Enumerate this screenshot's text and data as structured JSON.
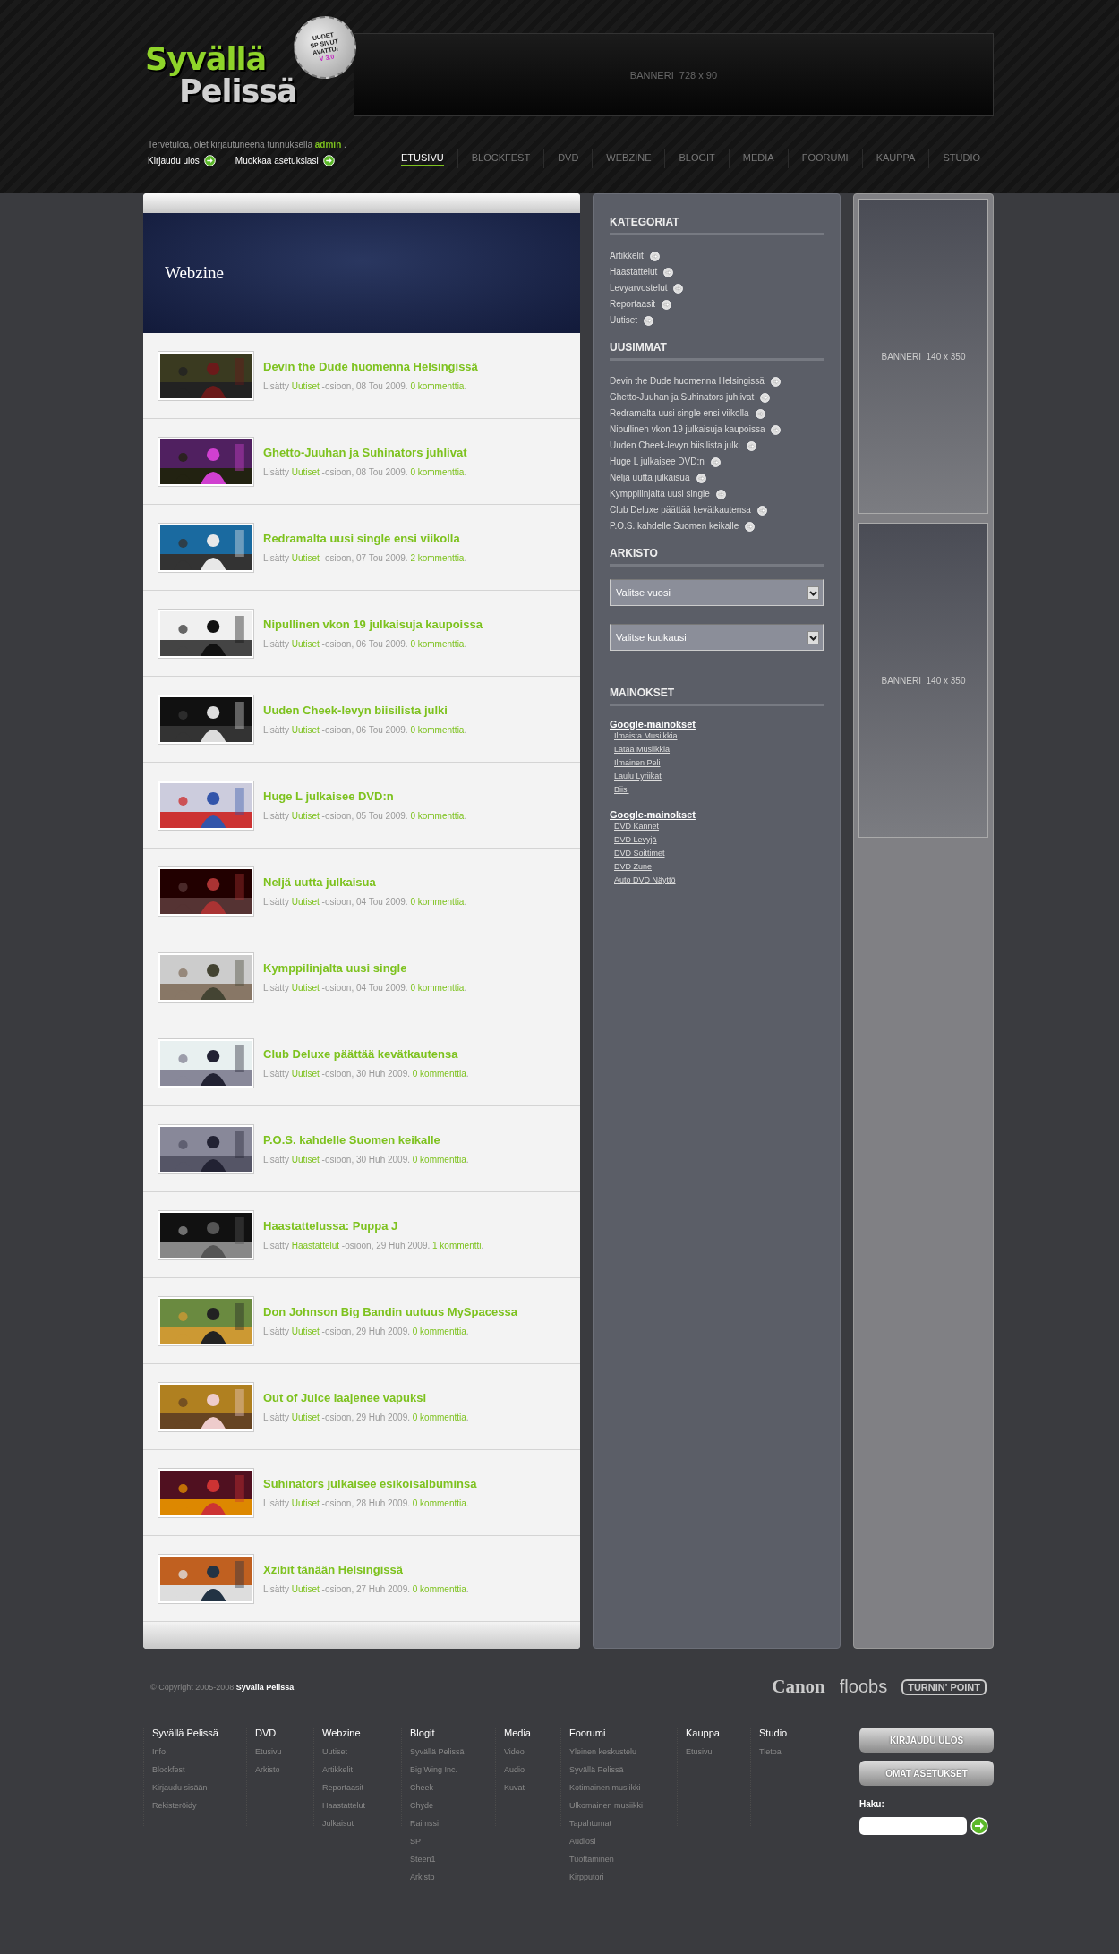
{
  "logo": {
    "line_1": "Syvällä",
    "line_2": "Pelissä",
    "badge": [
      "UUDET",
      "SP SIVUT",
      "AVATTU!"
    ],
    "badge_version": "V 3.0"
  },
  "top_banner": "BANNERI  728 x 90",
  "welcome": {
    "text_before": "Tervetuloa, olet kirjautuneena tunnuksella",
    "user": "admin",
    "text_after": "."
  },
  "user_links": [
    "Kirjaudu ulos",
    "Muokkaa asetuksiasi"
  ],
  "nav": [
    {
      "label": "ETUSIVU",
      "selected": true
    },
    {
      "label": "BLOCKFEST",
      "selected": false
    },
    {
      "label": "DVD",
      "selected": false
    },
    {
      "label": "WEBZINE",
      "selected": false
    },
    {
      "label": "BLOGIT",
      "selected": false
    },
    {
      "label": "MEDIA",
      "selected": false
    },
    {
      "label": "FOORUMI",
      "selected": false
    },
    {
      "label": "KAUPPA",
      "selected": false
    },
    {
      "label": "STUDIO",
      "selected": false
    }
  ],
  "section_title": "Webzine",
  "articles": [
    {
      "title": "Devin the Dude huomenna Helsingissä",
      "prefix": "Lisätty",
      "category": "Uutiset",
      "date": "-osioon, 08 Tou 2009.",
      "comments": "0 kommenttia",
      "end": "."
    },
    {
      "title": "Ghetto-Juuhan ja Suhinators juhlivat",
      "prefix": "Lisätty",
      "category": "Uutiset",
      "date": "-osioon, 08 Tou 2009.",
      "comments": "0 kommenttia",
      "end": "."
    },
    {
      "title": "Redramalta uusi single ensi viikolla",
      "prefix": "Lisätty",
      "category": "Uutiset",
      "date": "-osioon, 07 Tou 2009.",
      "comments": "2 kommenttia",
      "end": "."
    },
    {
      "title": "Nipullinen vkon 19 julkaisuja kaupoissa",
      "prefix": "Lisätty",
      "category": "Uutiset",
      "date": "-osioon, 06 Tou 2009.",
      "comments": "0 kommenttia",
      "end": "."
    },
    {
      "title": "Uuden Cheek-levyn biisilista julki",
      "prefix": "Lisätty",
      "category": "Uutiset",
      "date": "-osioon, 06 Tou 2009.",
      "comments": "0 kommenttia",
      "end": "."
    },
    {
      "title": "Huge L julkaisee DVD:n",
      "prefix": "Lisätty",
      "category": "Uutiset",
      "date": "-osioon, 05 Tou 2009.",
      "comments": "0 kommenttia",
      "end": "."
    },
    {
      "title": "Neljä uutta julkaisua",
      "prefix": "Lisätty",
      "category": "Uutiset",
      "date": "-osioon, 04 Tou 2009.",
      "comments": "0 kommenttia",
      "end": "."
    },
    {
      "title": "Kymppilinjalta uusi single",
      "prefix": "Lisätty",
      "category": "Uutiset",
      "date": "-osioon, 04 Tou 2009.",
      "comments": "0 kommenttia",
      "end": "."
    },
    {
      "title": "Club Deluxe päättää kevätkautensa",
      "prefix": "Lisätty",
      "category": "Uutiset",
      "date": "-osioon, 30 Huh 2009.",
      "comments": "0 kommenttia",
      "end": "."
    },
    {
      "title": "P.O.S. kahdelle Suomen keikalle",
      "prefix": "Lisätty",
      "category": "Uutiset",
      "date": "-osioon, 30 Huh 2009.",
      "comments": "0 kommenttia",
      "end": "."
    },
    {
      "title": "Haastattelussa: Puppa J",
      "prefix": "Lisätty",
      "category": "Haastattelut",
      "date": "-osioon, 29 Huh 2009.",
      "comments": "1 kommentti",
      "end": "."
    },
    {
      "title": "Don Johnson Big Bandin uutuus MySpacessa",
      "prefix": "Lisätty",
      "category": "Uutiset",
      "date": "-osioon, 29 Huh 2009.",
      "comments": "0 kommenttia",
      "end": "."
    },
    {
      "title": "Out of Juice laajenee vapuksi",
      "prefix": "Lisätty",
      "category": "Uutiset",
      "date": "-osioon, 29 Huh 2009.",
      "comments": "0 kommenttia",
      "end": "."
    },
    {
      "title": "Suhinators julkaisee esikoisalbuminsa",
      "prefix": "Lisätty",
      "category": "Uutiset",
      "date": "-osioon, 28 Huh 2009.",
      "comments": "0 kommenttia",
      "end": "."
    },
    {
      "title": "Xzibit tänään Helsingissä",
      "prefix": "Lisätty",
      "category": "Uutiset",
      "date": "-osioon, 27 Huh 2009.",
      "comments": "0 kommenttia",
      "end": "."
    }
  ],
  "sidebar": {
    "categories": {
      "title": "KATEGORIAT",
      "items": [
        "Artikkelit",
        "Haastattelut",
        "Levyarvostelut",
        "Reportaasit",
        "Uutiset"
      ]
    },
    "latest": {
      "title": "UUSIMMAT",
      "items": [
        "Devin the Dude huomenna Helsingissä",
        "Ghetto-Juuhan ja Suhinators juhlivat",
        "Redramalta uusi single ensi viikolla",
        "Nipullinen vkon 19 julkaisuja kaupoissa",
        "Uuden Cheek-levyn biisilista julki",
        "Huge L julkaisee DVD:n",
        "Neljä uutta julkaisua",
        "Kymppilinjalta uusi single",
        "Club Deluxe päättää kevätkautensa",
        "P.O.S. kahdelle Suomen keikalle"
      ]
    },
    "archive": {
      "title": "ARKISTO",
      "selects": [
        {
          "value": "Valitse vuosi"
        },
        {
          "value": "Valitse kuukausi"
        }
      ]
    },
    "ads": {
      "title": "MAINOKSET",
      "groups": [
        {
          "heading": "Google-mainokset",
          "links": [
            "Ilmaista Musiikkia",
            "Lataa Musiikkia",
            "Ilmainen Peli",
            "Laulu Lyriikat",
            "Biisi"
          ]
        },
        {
          "heading": "Google-mainokset",
          "links": [
            "DVD Kannet",
            "DVD Levyjä",
            "DVD Soittimet",
            "DVD Zune",
            "Auto DVD Näyttö"
          ]
        }
      ]
    }
  },
  "side_banners": [
    "BANNERI  140 x 350",
    "BANNERI  140 x 350"
  ],
  "footer": {
    "copyright": "© Copyright 2005-2008",
    "site": "Syvällä Pelissä",
    "copyright_end": ".",
    "sponsors": [
      "Canon",
      "floobs",
      "TURNIN' POINT"
    ],
    "columns": [
      {
        "heading": "Syvällä Pelissä",
        "links": [
          "Info",
          "Blockfest",
          "Kirjaudu sisään",
          "Rekisteröidy"
        ]
      },
      {
        "heading": "DVD",
        "links": [
          "Etusivu",
          "Arkisto"
        ]
      },
      {
        "heading": "Webzine",
        "links": [
          "Uutiset",
          "Artikkelit",
          "Reportaasit",
          "Haastattelut",
          "Julkaisut"
        ]
      },
      {
        "heading": "Blogit",
        "links": [
          "Syvällä Pelissä",
          "Big Wing Inc.",
          "Cheek",
          "Chyde",
          "Raimssi",
          "SP",
          "Steen1",
          "Arkisto"
        ]
      },
      {
        "heading": "Media",
        "links": [
          "Video",
          "Audio",
          "Kuvat"
        ]
      },
      {
        "heading": "Foorumi",
        "links": [
          "Yleinen keskustelu",
          "Syvällä Pelissä",
          "Kotimainen musiikki",
          "Ulkomainen musiikki",
          "Tapahtumat",
          "Audiosi",
          "Tuottaminen",
          "Kirpputori"
        ]
      },
      {
        "heading": "Kauppa",
        "links": [
          "Etusivu"
        ]
      },
      {
        "heading": "Studio",
        "links": [
          "Tietoa"
        ]
      }
    ],
    "buttons": [
      "KIRJAUDU ULOS",
      "OMAT ASETUKSET"
    ],
    "search_label": "Haku:"
  }
}
